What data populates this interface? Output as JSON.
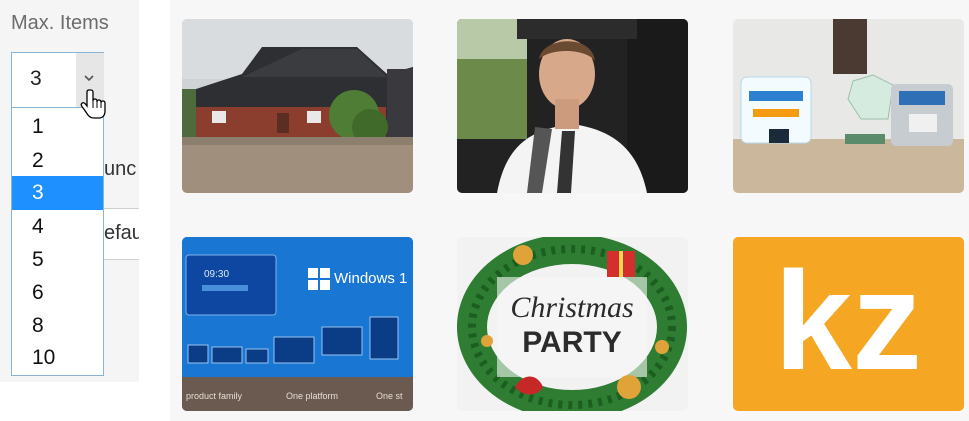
{
  "panel": {
    "max_items_label": "Max. Items",
    "selected_value": "3",
    "options": [
      "1",
      "2",
      "3",
      "4",
      "5",
      "6",
      "8",
      "10"
    ],
    "selected_index": 2,
    "obscured_text_1": "unc",
    "obscured_text_2": "efau"
  },
  "gallery": {
    "tiles": [
      {
        "subject": "barn-building"
      },
      {
        "subject": "man-in-car"
      },
      {
        "subject": "award-trophies"
      },
      {
        "subject": "windows-promo",
        "heading": "Windows 1",
        "clock": "09:30",
        "captions": [
          "product family",
          "One platform",
          "One st"
        ]
      },
      {
        "subject": "christmas-party",
        "line1": "Christmas",
        "line2": "PARTY"
      },
      {
        "subject": "kz-logo",
        "logo_text": "kz"
      }
    ]
  },
  "colors": {
    "accent": "#1e90ff",
    "kz_orange": "#f5a623",
    "windows_blue": "#1565c0"
  }
}
